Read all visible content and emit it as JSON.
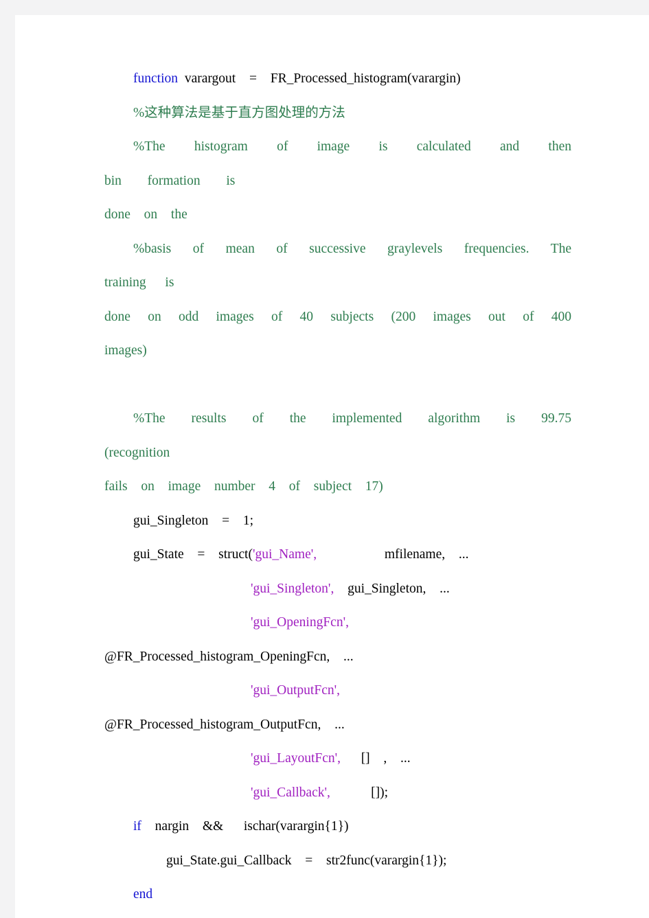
{
  "document": {
    "kind": "code-listing",
    "language": "MATLAB",
    "colors": {
      "keyword": "#1414d2",
      "comment": "#2e7d4f",
      "string": "#a020c0",
      "plain": "#000000",
      "page_background": "#ffffff",
      "gutter": "#f3f3f4"
    }
  },
  "code": {
    "line1": {
      "keyword": "function",
      "rest": " varargout  =  FR_Processed_histogram(varargin)"
    },
    "line2": {
      "comment": "%这种算法是基于直方图处理的方法"
    },
    "line3": {
      "comment": "%The  histogram  of  image  is  calculated  and  then  bin  formation  is"
    },
    "line4": {
      "comment": "done  on  the"
    },
    "line5": {
      "comment": "%basis  of  mean  of  successive  graylevels  frequencies.  The  training  is"
    },
    "line6": {
      "comment": "done  on  odd  images  of  40  subjects  (200  images  out  of  400  images)"
    },
    "line7": {
      "comment": ""
    },
    "line8": {
      "comment": "%The  results  of  the  implemented  algorithm  is  99.75  (recognition"
    },
    "line9": {
      "comment": "fails  on  image  number  4  of  subject  17)"
    },
    "line10": {
      "plain": "gui_Singleton  =  1;"
    },
    "line11": {
      "prefix": "gui_State  =  struct(",
      "string": "'gui_Name',",
      "suffix": "          mfilename,  ..."
    },
    "line12": {
      "string": "'gui_Singleton',",
      "suffix": "  gui_Singleton,  ..."
    },
    "line13": {
      "string": "'gui_OpeningFcn',"
    },
    "line14": {
      "plain": "@FR_Processed_histogram_OpeningFcn,  ..."
    },
    "line15": {
      "string": "'gui_OutputFcn',"
    },
    "line16": {
      "plain": "@FR_Processed_histogram_OutputFcn,  ..."
    },
    "line17": {
      "string": "'gui_LayoutFcn',",
      "suffix": "   []  ,  ..."
    },
    "line18": {
      "string": "'gui_Callback',",
      "suffix": "      []);"
    },
    "line19": {
      "keyword": "if",
      "rest": "  nargin  &&   ischar(varargin{1})"
    },
    "line20": {
      "plain": "gui_State.gui_Callback  =  str2func(varargin{1});"
    },
    "line21": {
      "keyword": "end"
    }
  }
}
